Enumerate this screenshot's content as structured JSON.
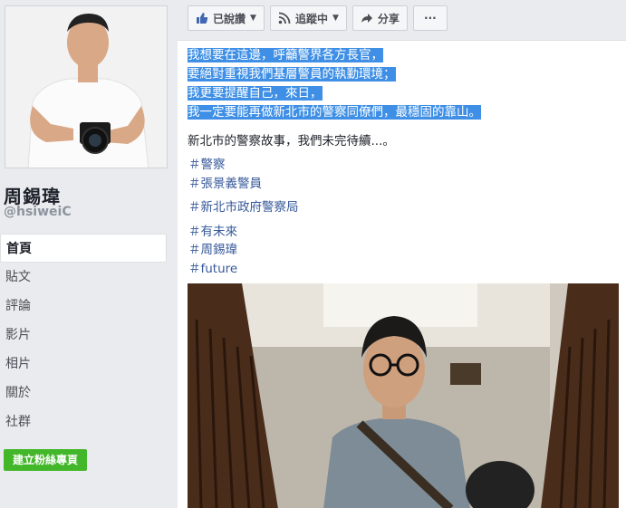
{
  "profile": {
    "name": "周錫瑋",
    "handle": "@hsiweiC"
  },
  "nav": {
    "items": [
      {
        "label": "首頁"
      },
      {
        "label": "貼文"
      },
      {
        "label": "評論"
      },
      {
        "label": "影片"
      },
      {
        "label": "相片"
      },
      {
        "label": "關於"
      },
      {
        "label": "社群"
      }
    ],
    "create_button": "建立粉絲專頁"
  },
  "toolbar": {
    "like_label": "已說讚",
    "follow_label": "追蹤中",
    "share_label": "分享",
    "more_label": "···"
  },
  "post": {
    "highlighted_lines": [
      "我想要在這邊，呼籲警界各方長官，",
      "要絕對重視我們基層警員的執勤環境；",
      "我更要提醒自己，來日，",
      "我一定要能再做新北市的警察同僚們，最穩固的靠山。"
    ],
    "paragraph": "新北市的警察故事，我們未完待續...。",
    "hashtags": [
      "＃警察",
      "＃張景義警員",
      "＃新北市政府警察局",
      "＃有未來",
      "＃周錫瑋",
      "＃future"
    ]
  },
  "colors": {
    "highlight": "#3e8fe5",
    "hashtag": "#365899",
    "create_button": "#42b72a"
  }
}
